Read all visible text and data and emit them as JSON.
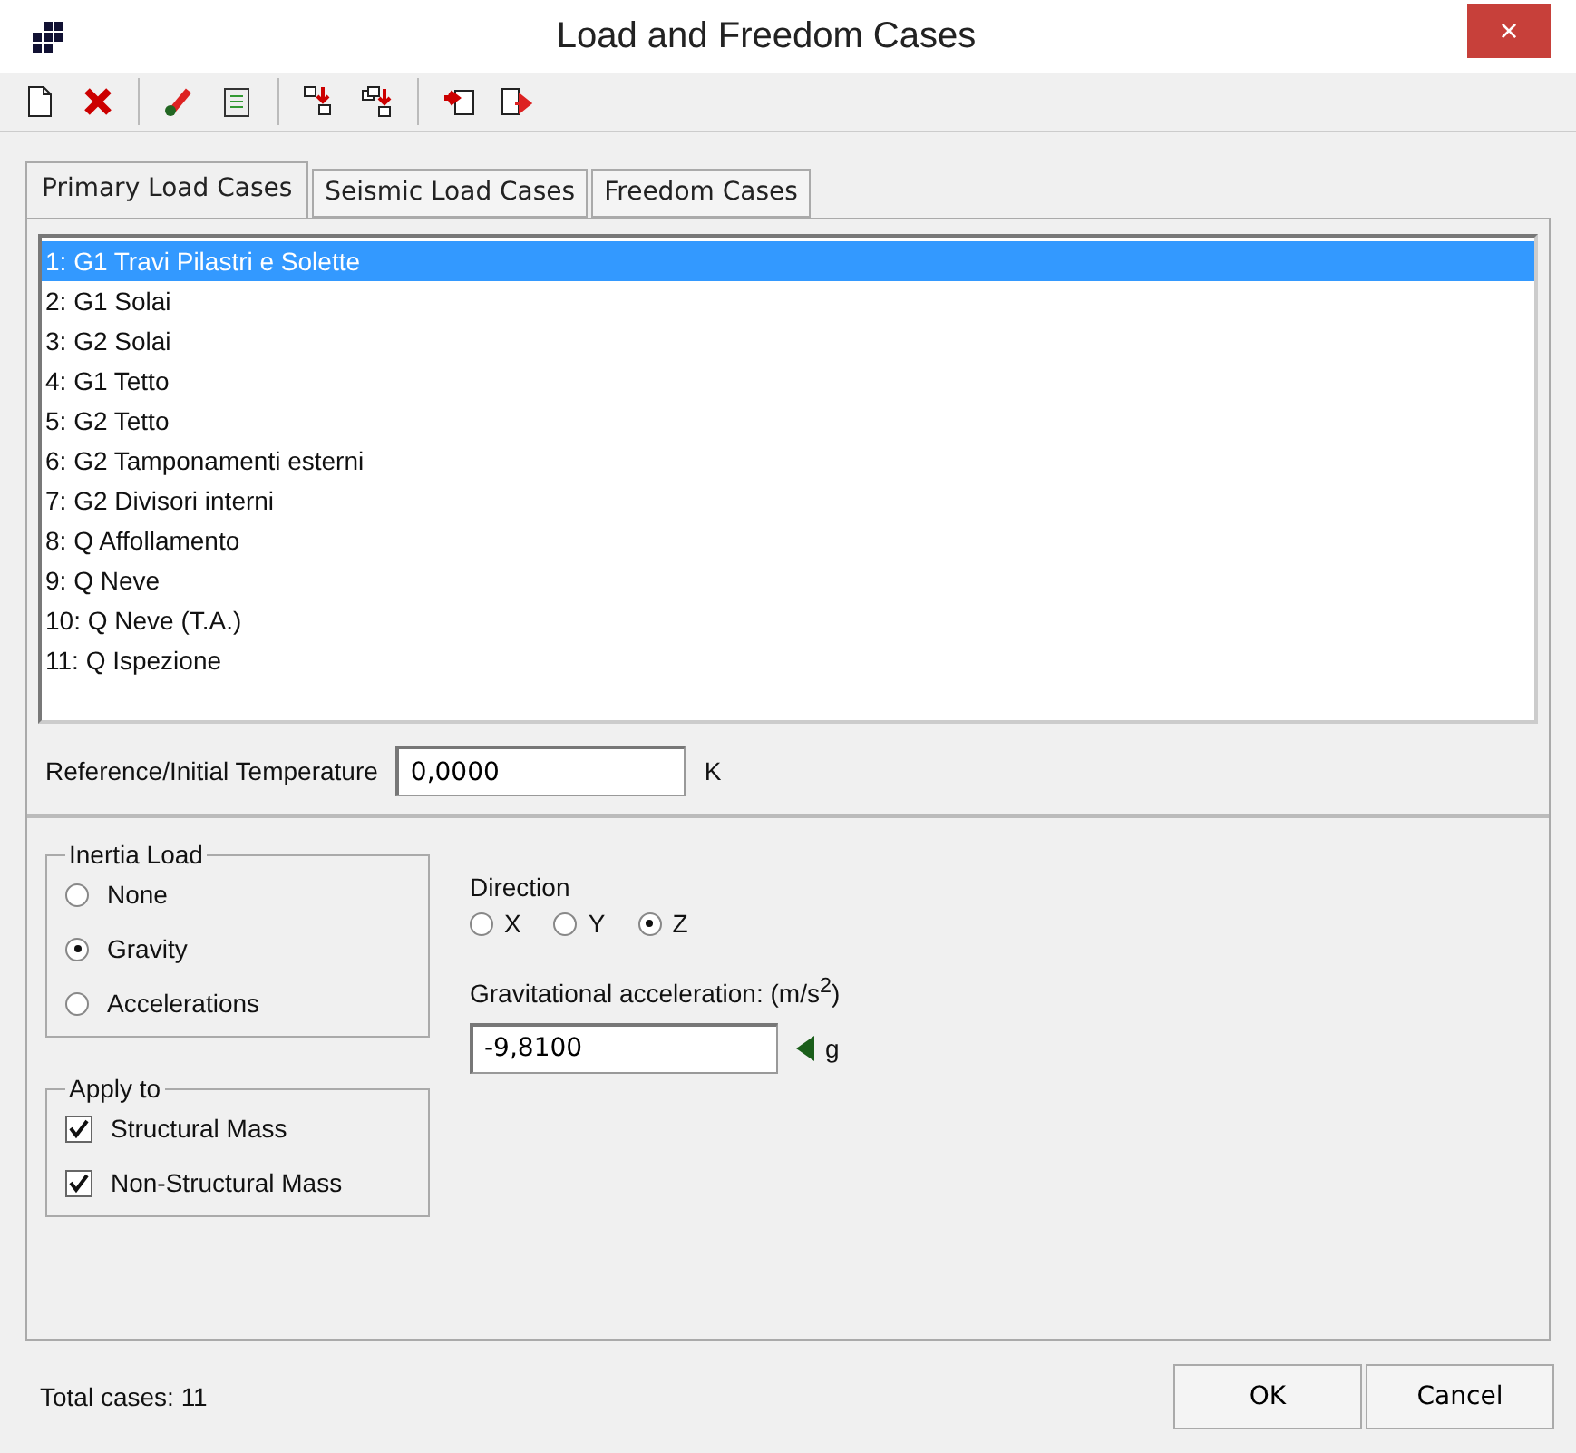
{
  "window": {
    "title": "Load and Freedom Cases",
    "close": "×"
  },
  "tabs": [
    {
      "label": "Primary Load Cases",
      "selected": true
    },
    {
      "label": "Seismic Load Cases",
      "selected": false
    },
    {
      "label": "Freedom Cases",
      "selected": false
    }
  ],
  "cases": [
    {
      "label": "1: G1 Travi Pilastri e Solette",
      "selected": true
    },
    {
      "label": "2: G1 Solai",
      "selected": false
    },
    {
      "label": "3: G2 Solai",
      "selected": false
    },
    {
      "label": "4: G1 Tetto",
      "selected": false
    },
    {
      "label": "5: G2 Tetto",
      "selected": false
    },
    {
      "label": "6: G2 Tamponamenti esterni",
      "selected": false
    },
    {
      "label": "7: G2 Divisori interni",
      "selected": false
    },
    {
      "label": "8: Q Affollamento",
      "selected": false
    },
    {
      "label": "9: Q Neve",
      "selected": false
    },
    {
      "label": "10: Q Neve (T.A.)",
      "selected": false
    },
    {
      "label": "11: Q Ispezione",
      "selected": false
    }
  ],
  "temperature": {
    "label": "Reference/Initial Temperature",
    "value": "0,0000",
    "unit": "K"
  },
  "inertia_load": {
    "title": "Inertia Load",
    "options": [
      {
        "label": "None",
        "selected": false
      },
      {
        "label": "Gravity",
        "selected": true
      },
      {
        "label": "Accelerations",
        "selected": false
      }
    ]
  },
  "direction": {
    "title": "Direction",
    "options": [
      {
        "label": "X",
        "selected": false
      },
      {
        "label": "Y",
        "selected": false
      },
      {
        "label": "Z",
        "selected": true
      }
    ]
  },
  "gravitational_acceleration": {
    "label": "Gravitational acceleration: (m/s$^{2}$)",
    "value": "-9,8100",
    "unit": "g"
  },
  "apply_to": {
    "title": "Apply to",
    "options": [
      {
        "label": "Structural Mass",
        "checked": true
      },
      {
        "label": "Non-Structural Mass",
        "checked": true
      }
    ]
  },
  "status": "Total cases: 11",
  "buttons": [
    "OK",
    "Cancel"
  ]
}
